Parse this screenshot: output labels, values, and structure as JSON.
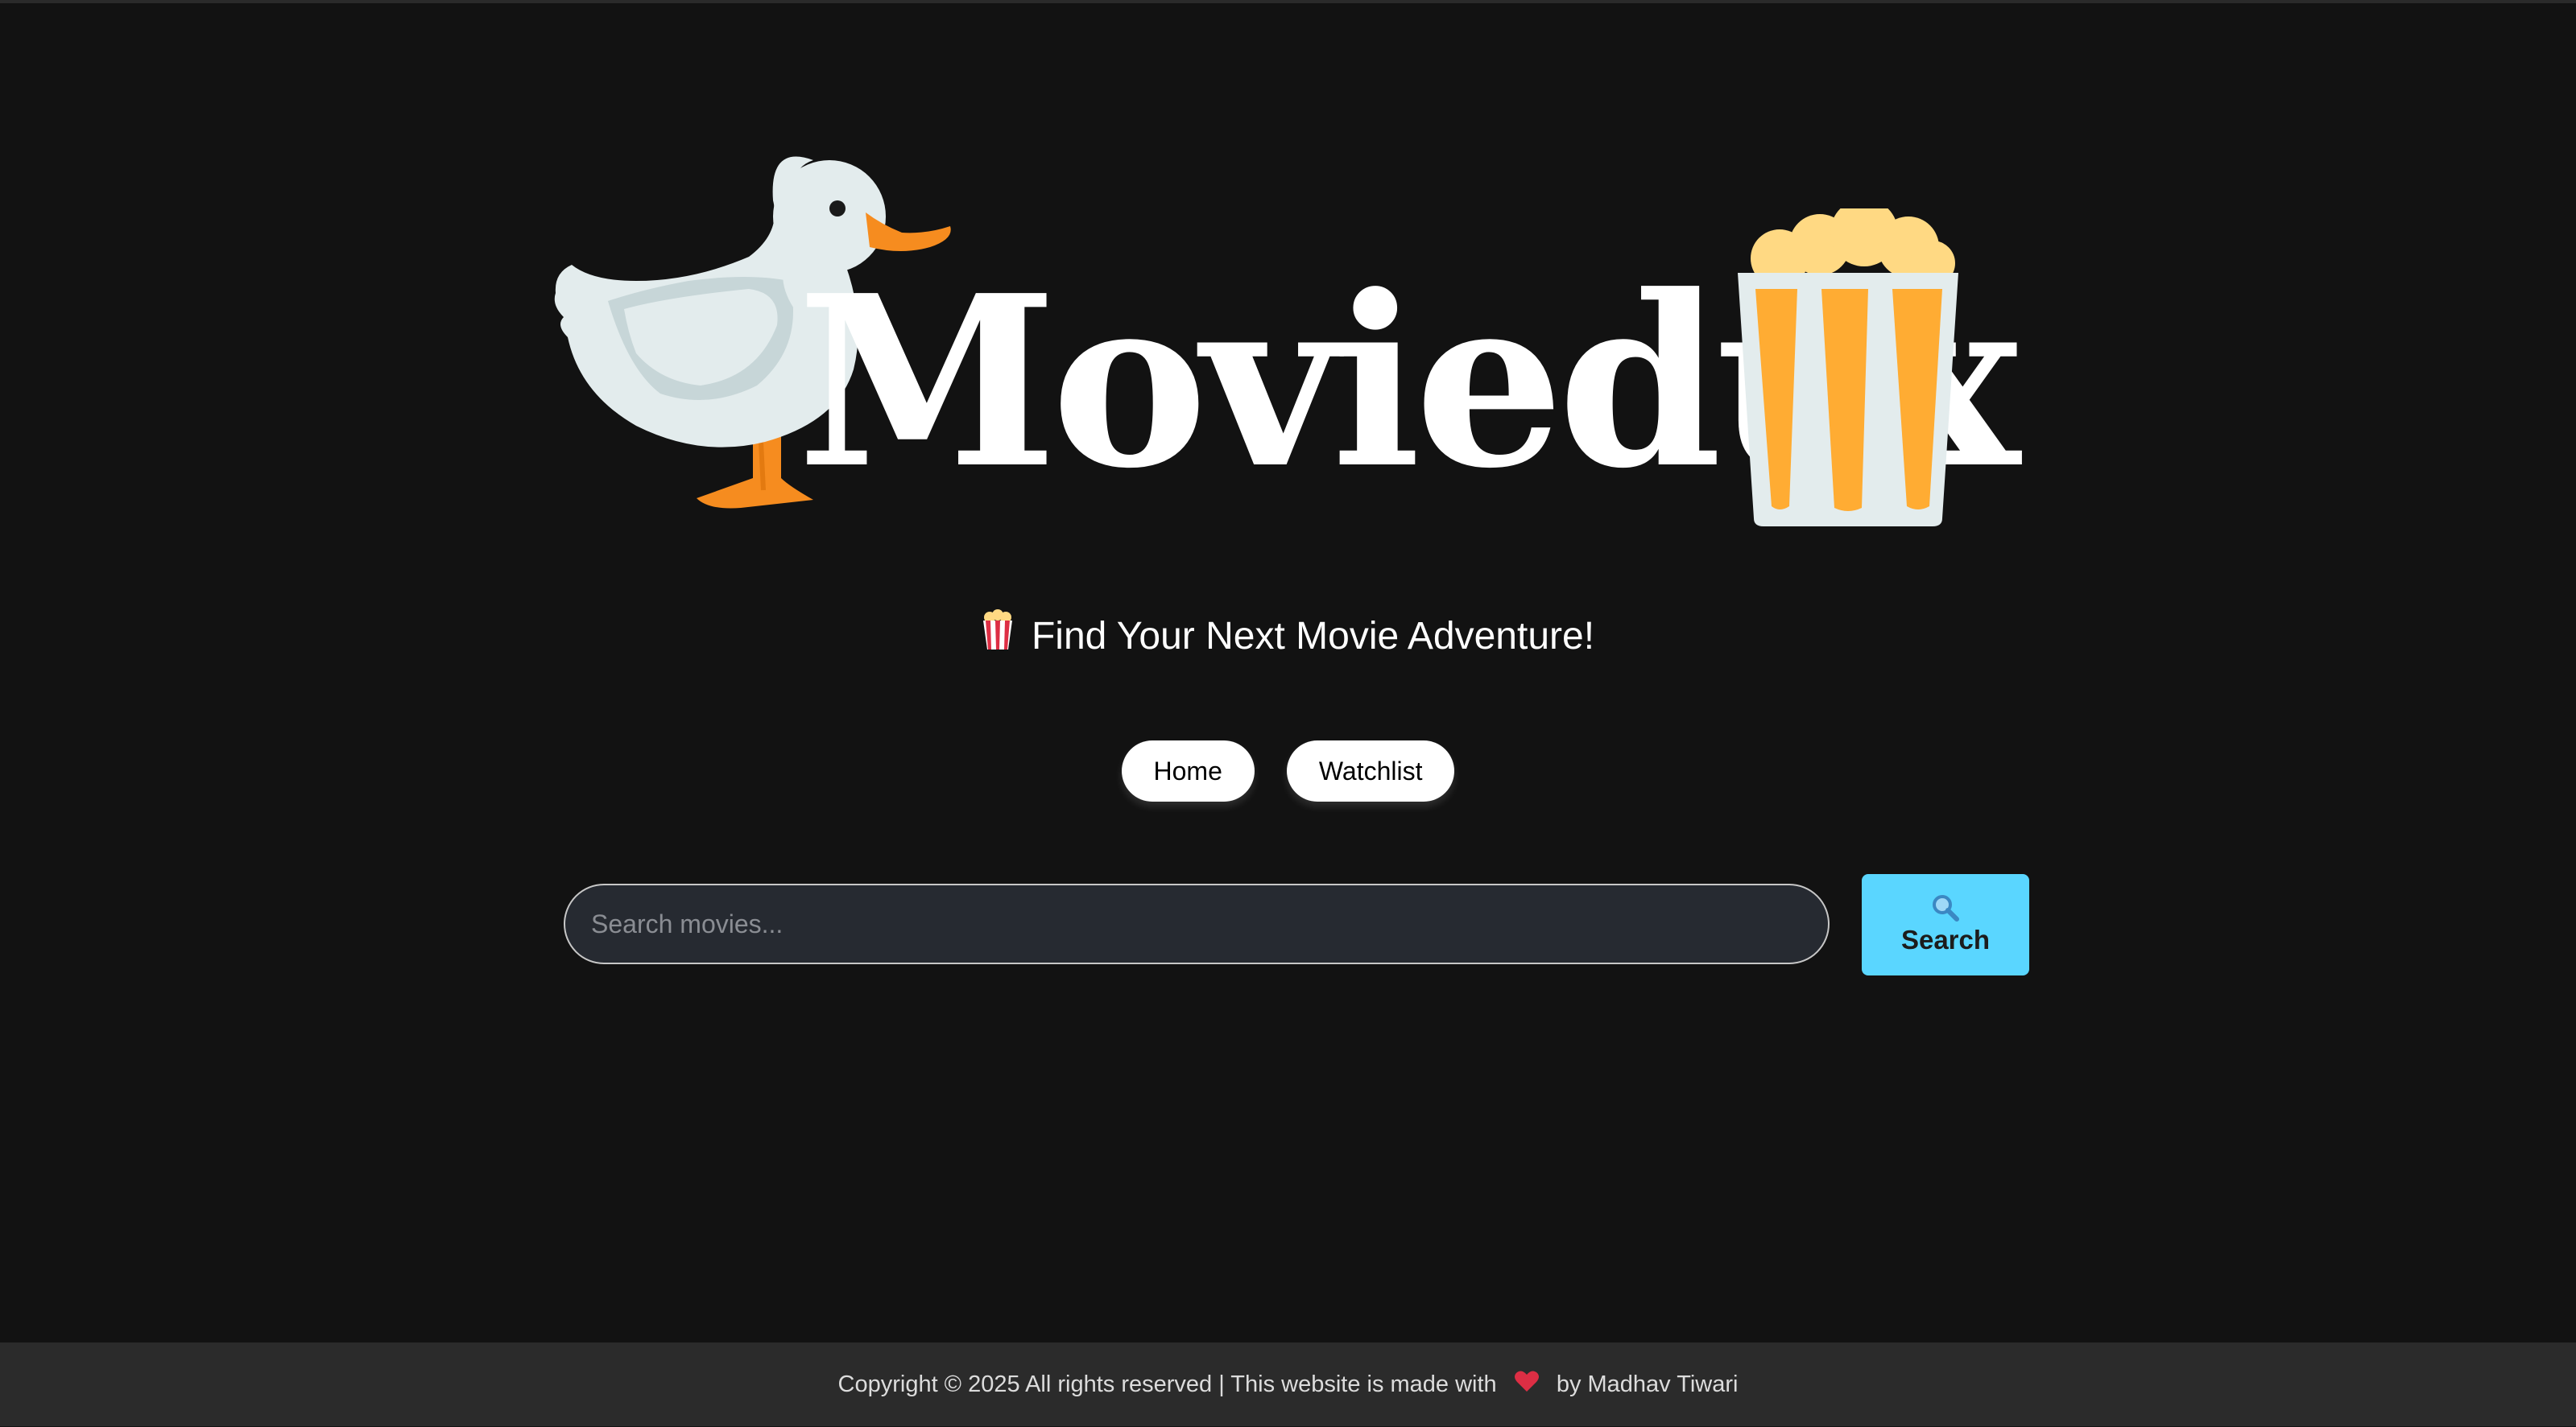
{
  "brand": {
    "logo_text": "Moviedux"
  },
  "header": {
    "tagline": "Find Your Next Movie Adventure!",
    "tagline_icon": "popcorn-icon"
  },
  "nav": {
    "home_label": "Home",
    "watchlist_label": "Watchlist"
  },
  "search": {
    "placeholder": "Search movies...",
    "value": "",
    "button_label": "Search",
    "button_icon": "magnifier-icon"
  },
  "footer": {
    "text_before": "Copyright © 2025 All rights reserved | This website is made with",
    "heart_icon": "heart-icon",
    "text_after": "by Madhav Tiwari"
  },
  "colors": {
    "background": "#121212",
    "footer_bg": "#2b2b2b",
    "accent": "#5ad6ff",
    "input_bg": "#262a31"
  }
}
